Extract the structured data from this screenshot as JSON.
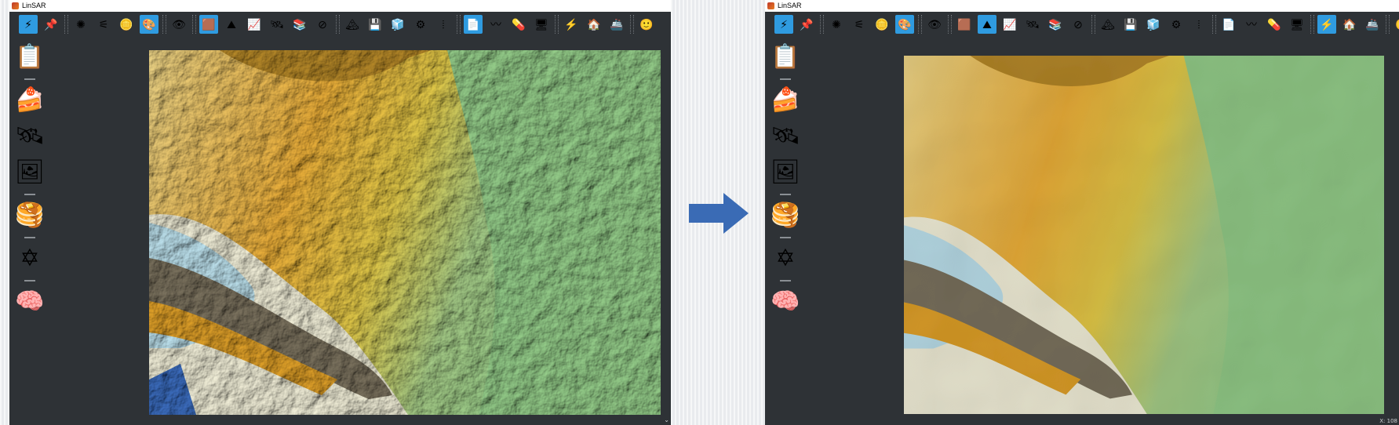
{
  "windows": [
    {
      "title": "LinSAR",
      "toolbar": {
        "groups": [
          [
            {
              "icon": "wand-icon",
              "glyph": "⚡︎",
              "active": true
            },
            {
              "icon": "pin-icon",
              "glyph": "📌"
            }
          ],
          [
            {
              "icon": "bug-icon",
              "glyph": "✺"
            },
            {
              "icon": "network-icon",
              "glyph": "⚟"
            },
            {
              "icon": "coin-icon",
              "glyph": "🪙"
            },
            {
              "icon": "paint-icon",
              "glyph": "🎨",
              "active": true
            }
          ],
          [
            {
              "icon": "eye-icon",
              "glyph": "👁"
            }
          ],
          [
            {
              "icon": "layers-icon",
              "glyph": "🟫",
              "active": true
            },
            {
              "icon": "terrain-icon",
              "glyph": "⛰"
            },
            {
              "icon": "chart-icon",
              "glyph": "📈"
            },
            {
              "icon": "satellite-icon",
              "glyph": "🛰"
            },
            {
              "icon": "stack-icon",
              "glyph": "📚"
            },
            {
              "icon": "forbidden-icon",
              "glyph": "⊘"
            }
          ],
          [
            {
              "icon": "mountain-icon",
              "glyph": "🏔"
            },
            {
              "icon": "save-icon",
              "glyph": "💾"
            },
            {
              "icon": "cube-icon",
              "glyph": "🧊"
            },
            {
              "icon": "gear-icon",
              "glyph": "⚙"
            },
            {
              "icon": "bars-icon",
              "glyph": "⦙"
            }
          ],
          [
            {
              "icon": "document-icon",
              "glyph": "📄",
              "active": true
            },
            {
              "icon": "wave-icon",
              "glyph": "〰"
            },
            {
              "icon": "pill-icon",
              "glyph": "💊"
            },
            {
              "icon": "monitor-icon",
              "glyph": "🖥"
            }
          ],
          [
            {
              "icon": "lightning-icon",
              "glyph": "⚡"
            },
            {
              "icon": "home-icon",
              "glyph": "🏠"
            },
            {
              "icon": "ship-icon",
              "glyph": "🚢"
            }
          ],
          [
            {
              "icon": "face-icon",
              "glyph": "🙂"
            }
          ]
        ]
      },
      "sidebar": [
        {
          "icon": "document-icon",
          "glyph": "📋"
        },
        {
          "icon": "soil-layers-icon",
          "glyph": "🍰"
        },
        {
          "icon": "satellite-icon",
          "glyph": "🛰"
        },
        {
          "icon": "image-settings-icon",
          "glyph": "🖼"
        },
        {
          "icon": "layer-stack-icon",
          "glyph": "🥞"
        },
        {
          "icon": "star-icon",
          "glyph": "✡"
        },
        {
          "icon": "brain-icon",
          "glyph": "🧠"
        }
      ],
      "statusbar": {
        "coordinate": ""
      }
    },
    {
      "title": "LinSAR",
      "toolbar": {
        "groups": [
          [
            {
              "icon": "wand-icon",
              "glyph": "⚡︎",
              "active": true
            },
            {
              "icon": "pin-icon",
              "glyph": "📌"
            }
          ],
          [
            {
              "icon": "bug-icon",
              "glyph": "✺"
            },
            {
              "icon": "network-icon",
              "glyph": "⚟"
            },
            {
              "icon": "coin-icon",
              "glyph": "🪙"
            },
            {
              "icon": "paint-icon",
              "glyph": "🎨",
              "active": true
            }
          ],
          [
            {
              "icon": "eye-icon",
              "glyph": "👁"
            }
          ],
          [
            {
              "icon": "layers-icon",
              "glyph": "🟫"
            },
            {
              "icon": "terrain-icon",
              "glyph": "⛰",
              "active": true
            },
            {
              "icon": "chart-icon",
              "glyph": "📈"
            },
            {
              "icon": "satellite-icon",
              "glyph": "🛰"
            },
            {
              "icon": "stack-icon",
              "glyph": "📚"
            },
            {
              "icon": "forbidden-icon",
              "glyph": "⊘"
            }
          ],
          [
            {
              "icon": "mountain-icon",
              "glyph": "🏔"
            },
            {
              "icon": "save-icon",
              "glyph": "💾"
            },
            {
              "icon": "cube-icon",
              "glyph": "🧊"
            },
            {
              "icon": "gear-icon",
              "glyph": "⚙"
            },
            {
              "icon": "bars-icon",
              "glyph": "⦙"
            }
          ],
          [
            {
              "icon": "document-icon",
              "glyph": "📄"
            },
            {
              "icon": "wave-icon",
              "glyph": "〰"
            },
            {
              "icon": "pill-icon",
              "glyph": "💊"
            },
            {
              "icon": "monitor-icon",
              "glyph": "🖥"
            }
          ],
          [
            {
              "icon": "lightning-icon",
              "glyph": "⚡",
              "active": true
            },
            {
              "icon": "home-icon",
              "glyph": "🏠"
            },
            {
              "icon": "ship-icon",
              "glyph": "🚢"
            }
          ],
          [
            {
              "icon": "face-icon",
              "glyph": "🙂"
            }
          ]
        ]
      },
      "sidebar": [
        {
          "icon": "document-icon",
          "glyph": "📋"
        },
        {
          "icon": "soil-layers-icon",
          "glyph": "🍰"
        },
        {
          "icon": "satellite-icon",
          "glyph": "🛰"
        },
        {
          "icon": "image-settings-icon",
          "glyph": "🖼"
        },
        {
          "icon": "layer-stack-icon",
          "glyph": "🥞"
        },
        {
          "icon": "star-icon",
          "glyph": "✡"
        },
        {
          "icon": "brain-icon",
          "glyph": "🧠"
        }
      ],
      "statusbar": {
        "coordinate": "X: 108"
      }
    }
  ],
  "colors": {
    "window_bg": "#2e3236",
    "active_button": "#2f9be0",
    "arrow": "#3a6bb5"
  }
}
